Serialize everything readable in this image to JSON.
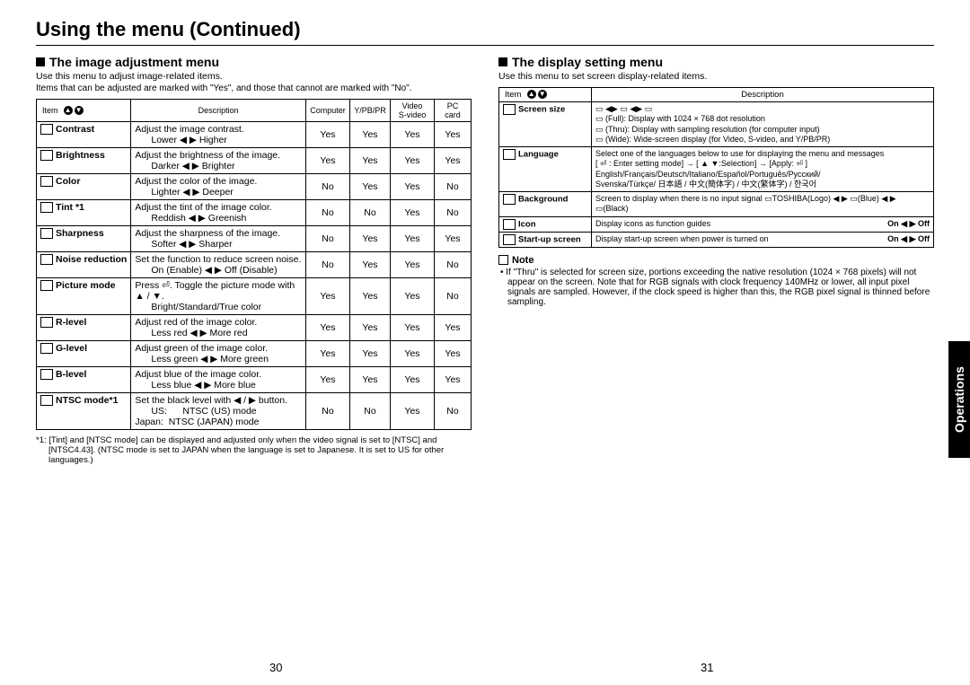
{
  "title": "Using the menu (Continued)",
  "left": {
    "heading": "The image adjustment menu",
    "intro": "Use this menu to adjust image-related items.",
    "sub": "Items that can be adjusted are marked with  \"Yes\", and those that cannot are marked with \"No\".",
    "headers": {
      "item": "Item",
      "desc": "Description",
      "c1": "Computer",
      "c2": "Y/PB/PR",
      "c3": "Video\nS-video",
      "c4": "PC\ncard"
    },
    "rows": [
      {
        "name": "Contrast",
        "d1": "Adjust the image contrast.",
        "d2": "Lower ◀ ▶ Higher",
        "v": [
          "Yes",
          "Yes",
          "Yes",
          "Yes"
        ]
      },
      {
        "name": "Brightness",
        "d1": "Adjust the brightness of the image.",
        "d2": "Darker ◀ ▶ Brighter",
        "v": [
          "Yes",
          "Yes",
          "Yes",
          "Yes"
        ]
      },
      {
        "name": "Color",
        "d1": "Adjust the color of the image.",
        "d2": "Lighter ◀ ▶ Deeper",
        "v": [
          "No",
          "Yes",
          "Yes",
          "No"
        ]
      },
      {
        "name": "Tint *1",
        "d1": "Adjust the tint of the image color.",
        "d2": "Reddish ◀ ▶ Greenish",
        "v": [
          "No",
          "No",
          "Yes",
          "No"
        ]
      },
      {
        "name": "Sharpness",
        "d1": "Adjust the sharpness of the image.",
        "d2": "Softer ◀ ▶ Sharper",
        "v": [
          "No",
          "Yes",
          "Yes",
          "Yes"
        ]
      },
      {
        "name": "Noise reduction",
        "d1": "Set the function to reduce screen noise.",
        "d2": "On (Enable) ◀ ▶ Off (Disable)",
        "v": [
          "No",
          "Yes",
          "Yes",
          "No"
        ]
      },
      {
        "name": "Picture mode",
        "d1": "Press ⏎. Toggle the picture mode with ▲ / ▼.",
        "d2": "Bright/Standard/True color",
        "v": [
          "Yes",
          "Yes",
          "Yes",
          "No"
        ]
      },
      {
        "name": "R-level",
        "d1": "Adjust red of the image color.",
        "d2": "Less red ◀ ▶ More red",
        "v": [
          "Yes",
          "Yes",
          "Yes",
          "Yes"
        ]
      },
      {
        "name": "G-level",
        "d1": "Adjust green of the image color.",
        "d2": "Less green ◀ ▶ More green",
        "v": [
          "Yes",
          "Yes",
          "Yes",
          "Yes"
        ]
      },
      {
        "name": "B-level",
        "d1": "Adjust blue of the image color.",
        "d2": "Less blue ◀ ▶ More blue",
        "v": [
          "Yes",
          "Yes",
          "Yes",
          "Yes"
        ]
      },
      {
        "name": "NTSC mode*1",
        "d1": "Set the black level with ◀ / ▶ button.",
        "d2": "US:      NTSC (US) mode\nJapan:  NTSC (JAPAN) mode",
        "v": [
          "No",
          "No",
          "Yes",
          "No"
        ]
      }
    ],
    "footnote": "*1: [Tint] and [NTSC mode] can be displayed and adjusted only when the video signal is set to [NTSC] and [NTSC4.43]. (NTSC mode is set to JAPAN when the language is set to Japanese. It is set to US for other languages.)"
  },
  "right": {
    "heading": "The display setting menu",
    "intro": "Use this menu to set screen display-related items.",
    "headers": {
      "item": "Item",
      "desc": "Description"
    },
    "rows": [
      {
        "name": "Screen size",
        "d": "▭ ◀▶ ▭ ◀▶ ▭\n▭ (Full):  Display with 1024 × 768 dot resolution\n▭ (Thru): Display with sampling resolution (for computer input)\n▭ (Wide):  Wide-screen display (for Video, S-video, and Y/PB/PR)"
      },
      {
        "name": "Language",
        "d": "Select one of the languages below to use for displaying the menu and messages\n[ ⏎ : Enter setting mode] → [ ▲ ▼:Selection] → [Apply: ⏎ ]\nEnglish/Français/Deutsch/Italiano/Español/Português/Русский/\nSvenska/Türkçe/ 日本語 / 中文(簡体字) / 中文(繁体字) / 한국어"
      },
      {
        "name": "Background",
        "d": "Screen to display when there is no input signal  ▭TOSHIBA(Logo) ◀ ▶ ▭(Blue) ◀ ▶ ▭(Black)"
      },
      {
        "name": "Icon",
        "d": "Display icons as function guides",
        "tail": "On ◀ ▶ Off"
      },
      {
        "name": "Start-up screen",
        "d": "Display start-up screen when power is turned on",
        "tail": "On ◀ ▶ Off"
      }
    ],
    "noteHead": "Note",
    "note": "• If \"Thru\" is selected for screen size, portions exceeding the native resolution (1024 × 768 pixels) will not appear on the screen. Note that for RGB signals with clock frequency 140MHz or lower, all input pixel signals are sampled. However, if the clock speed is higher than this, the RGB pixel signal is thinned before sampling."
  },
  "tab": "Operations",
  "pageLeft": "30",
  "pageRight": "31"
}
